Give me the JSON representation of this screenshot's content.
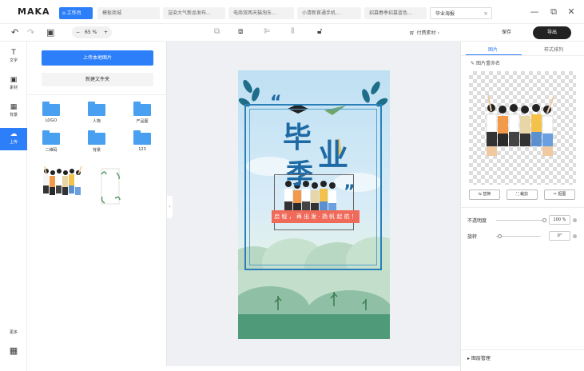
{
  "app": {
    "logo": "MAKA"
  },
  "tabs": [
    {
      "label": "工作台"
    },
    {
      "label": "模板商城"
    },
    {
      "label": "渲染大气新品发布..."
    },
    {
      "label": "电商双两天猫淘东..."
    },
    {
      "label": "小清新首通手机..."
    },
    {
      "label": "招募春季招募蓝色..."
    },
    {
      "label": "毕业海报"
    }
  ],
  "window": {
    "minimize": "—",
    "restore": "⧉",
    "close": "✕"
  },
  "toolbar": {
    "undo": "↶",
    "redo": "↷",
    "layout": "▣",
    "zoom_minus": "−",
    "zoom_value": "65 %",
    "zoom_plus": "+",
    "material": "付费素材 ›",
    "save": "保存",
    "export": "导出"
  },
  "rail": {
    "items": [
      {
        "icon": "T",
        "label": "文字"
      },
      {
        "icon": "▣",
        "label": "素材"
      },
      {
        "icon": "▦",
        "label": "背景"
      },
      {
        "icon": "☁",
        "label": "上传"
      }
    ],
    "more": "更多"
  },
  "panel": {
    "upload_button": "上传本地图片",
    "new_folder": "新建文件夹",
    "folders": [
      "LOGO",
      "人物",
      "产品图",
      "二维码",
      "背景",
      "123"
    ]
  },
  "poster": {
    "title_line1": "毕",
    "title_line2": "业",
    "title_line3": "季",
    "quote_open": "“",
    "quote_close": "”",
    "banner": "启 程 ， 再 出 发 · 扬 帆 起 航 ！"
  },
  "rpanel": {
    "tab_image": "图片",
    "tab_style": "样式排列",
    "image_name": "图片重命名",
    "btn_replace": "⇆ 替换",
    "btn_crop": "⛶ 裁剪",
    "btn_cutout": "✂ 抠图",
    "opacity_label": "不透明度",
    "opacity_value": "100 %",
    "rotate_label": "旋转",
    "rotate_value": "0°",
    "layer_manager": "▸ 图层管理"
  },
  "colors": {
    "accent": "#2d7ff9",
    "export_bg": "#222222",
    "poster_blue": "#1d6aa5",
    "banner_red": "#f06a5a"
  }
}
